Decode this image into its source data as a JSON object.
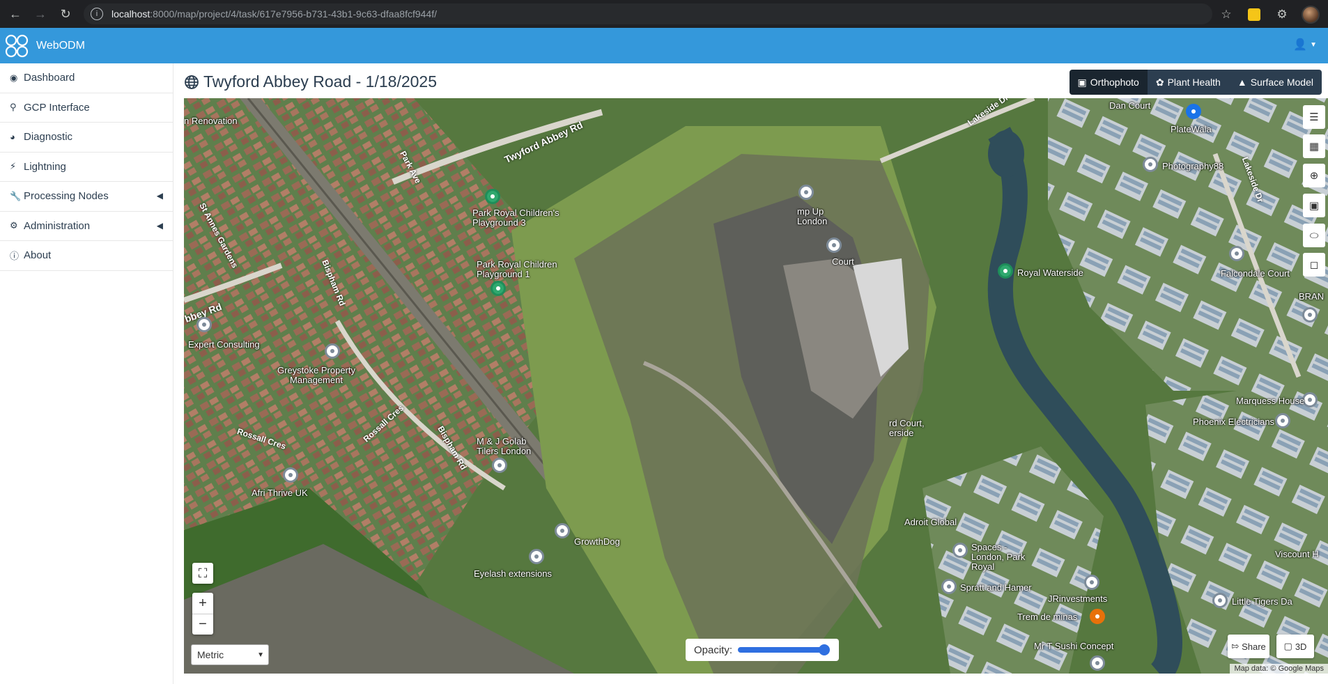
{
  "browser": {
    "url_host": "localhost",
    "url_path": ":8000/map/project/4/task/617e7956-b731-43b1-9c63-dfaa8fcf944f/"
  },
  "header": {
    "brand": "WebODM"
  },
  "sidebar": {
    "items": [
      {
        "label": "Dashboard",
        "icon": "dashboard-icon"
      },
      {
        "label": "GCP Interface",
        "icon": "map-marker-icon"
      },
      {
        "label": "Diagnostic",
        "icon": "pie-chart-icon"
      },
      {
        "label": "Lightning",
        "icon": "bolt-icon"
      },
      {
        "label": "Processing Nodes",
        "icon": "wrench-icon"
      },
      {
        "label": "Administration",
        "icon": "cogs-icon"
      },
      {
        "label": "About",
        "icon": "info-icon"
      }
    ]
  },
  "main": {
    "title": "Twyford Abbey Road - 1/18/2025",
    "layer_tabs": [
      {
        "label": "Orthophoto",
        "active": true
      },
      {
        "label": "Plant Health",
        "active": false
      },
      {
        "label": "Surface Model",
        "active": false
      }
    ]
  },
  "map": {
    "roads": [
      "Twyford Abbey Rd",
      "Park Ave",
      "St Annes Gardens",
      "Bispham Rd",
      "Rossall Cres",
      "Rossall Cres",
      "Bispham Rd",
      "Lakeside Dr",
      "Lakeside Dr",
      "bbey Rd"
    ],
    "places": [
      "n Renovation",
      "Park Royal Children's Playground 3",
      "Park Royal Children Playground 1",
      "Expert Consulting",
      "Greystoke Property Management",
      "M & J Golab Tilers London",
      "Afri Thrive UK",
      "GrowthDog",
      "Eyelash extensions",
      "mp Up London",
      "Court",
      "Royal Waterside",
      "Dan Court",
      "PlateWala",
      "Photography88",
      "Falcondale Court",
      "BRAN",
      "Marquess House",
      "Phoenix Electricians",
      "rd Court, erside",
      "Adroit Global",
      "Spaces - London, Park Royal",
      "Spratt and Hamer",
      "JRinvestments",
      "Trem de minas",
      "Mr T Sushi Concept",
      "Little Tigers Da",
      "Viscount H"
    ],
    "units": "Metric",
    "opacity_label": "Opacity:",
    "opacity_value": 1.0,
    "share_label": "Share",
    "view3d_label": "3D",
    "attribution": "Map data: © Google Maps"
  }
}
